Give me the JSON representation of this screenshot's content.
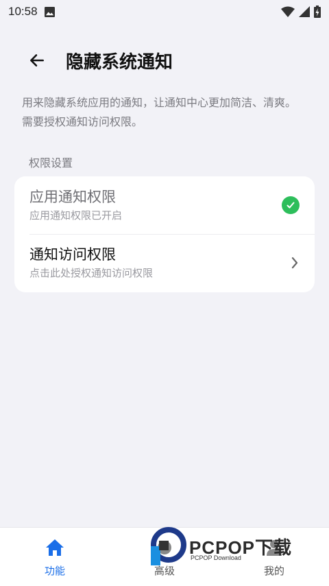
{
  "status_bar": {
    "time": "10:58",
    "icons": [
      "image-icon",
      "wifi-icon",
      "signal-icon",
      "battery-icon"
    ]
  },
  "header": {
    "title": "隐藏系统通知",
    "back_icon": "arrow-left-icon"
  },
  "description": "用来隐藏系统应用的通知，让通知中心更加简洁、清爽。需要授权通知访问权限。",
  "section": {
    "label": "权限设置",
    "items": [
      {
        "title": "应用通知权限",
        "subtitle": "应用通知权限已开启",
        "trailing_icon": "check-circle-icon"
      },
      {
        "title": "通知访问权限",
        "subtitle": "点击此处授权通知访问权限",
        "trailing_icon": "chevron-right-icon"
      }
    ]
  },
  "bottom_nav": {
    "items": [
      {
        "label": "功能",
        "icon": "home-icon",
        "active": true
      },
      {
        "label": "高级",
        "icon": "advanced-icon",
        "active": false
      },
      {
        "label": "我的",
        "icon": "person-icon",
        "active": false
      }
    ]
  },
  "watermark": {
    "text": "PCPOP下载",
    "subtext": "PCPOP Download"
  },
  "colors": {
    "background": "#f2f2f7",
    "accent": "#1a6ee8",
    "success": "#2dbe5b"
  }
}
